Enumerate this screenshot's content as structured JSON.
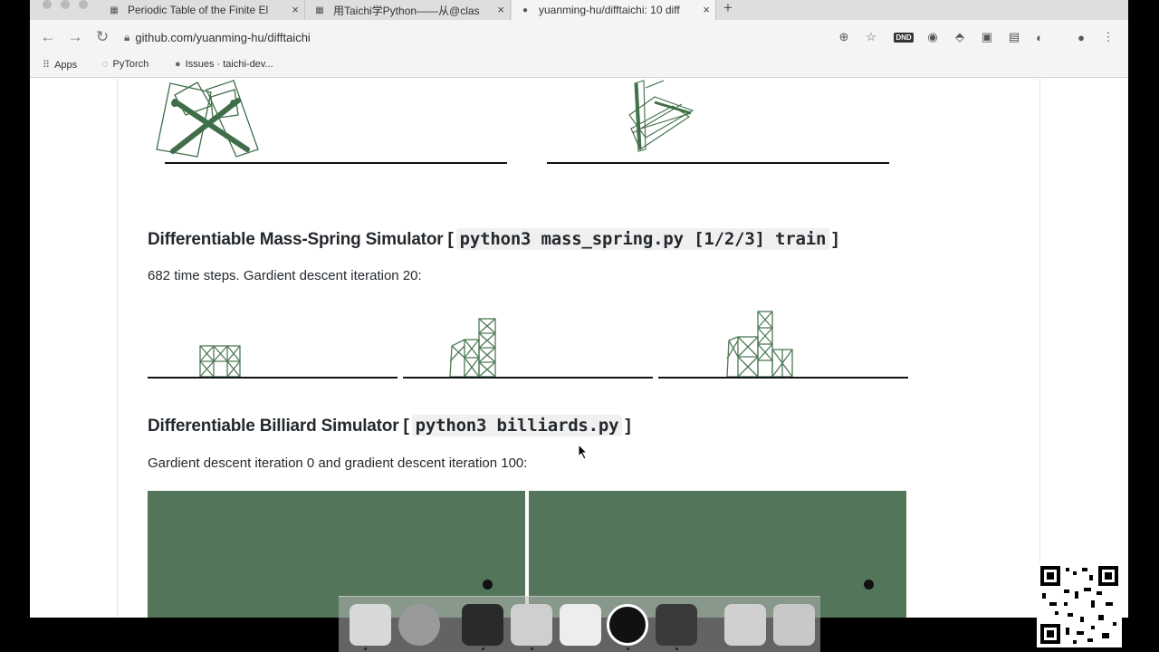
{
  "browser": {
    "tabs": [
      {
        "title": "Periodic Table of the Finite El",
        "active": false
      },
      {
        "title": "用Taichi学Python——从@clas",
        "active": false
      },
      {
        "title": "yuanming-hu/difftaichi: 10 diff",
        "active": true
      }
    ],
    "new_tab_label": "+",
    "url": "github.com/yuanming-hu/difftaichi",
    "extension_badge": "DND",
    "bookmarks": [
      {
        "label": "Apps",
        "icon": "apps-grid-icon"
      },
      {
        "label": "PyTorch",
        "icon": "pytorch-icon"
      },
      {
        "label": "Issues · taichi-dev...",
        "icon": "github-icon"
      }
    ]
  },
  "readme": {
    "mass_spring": {
      "heading_text": "Differentiable Mass-Spring Simulator [",
      "heading_code": "python3 mass_spring.py [1/2/3] train",
      "heading_close": "]",
      "caption": "682 time steps. Gardient descent iteration 20:"
    },
    "billiard": {
      "heading_text": "Differentiable Billiard Simulator [",
      "heading_code": "python3 billiards.py",
      "heading_close": "]",
      "caption": "Gardient descent iteration 0 and gradient descent iteration 100:"
    }
  },
  "colors": {
    "billiard_table": "#537559",
    "robot_stroke": "#3f6e48",
    "ground": "#111111"
  }
}
